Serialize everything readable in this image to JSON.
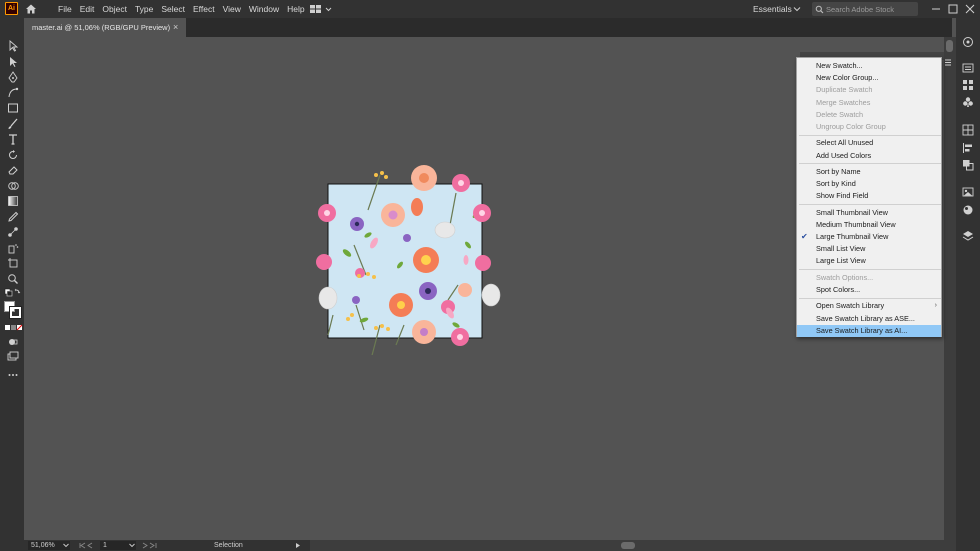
{
  "app": {
    "logo_text": "Ai",
    "menus": [
      "File",
      "Edit",
      "Object",
      "Type",
      "Select",
      "Effect",
      "View",
      "Window",
      "Help"
    ],
    "workspace": "Essentials",
    "search_placeholder": "Search Adobe Stock"
  },
  "document": {
    "tab_title": "master.ai @ 51,06% (RGB/GPU Preview)",
    "close_glyph": "×"
  },
  "status": {
    "zoom": "51,06%",
    "artboard": "1",
    "tool": "Selection"
  },
  "flyout": {
    "groups": [
      [
        {
          "label": "New Swatch...",
          "disabled": false
        },
        {
          "label": "New Color Group...",
          "disabled": false
        },
        {
          "label": "Duplicate Swatch",
          "disabled": true
        },
        {
          "label": "Merge Swatches",
          "disabled": true
        },
        {
          "label": "Delete Swatch",
          "disabled": true
        },
        {
          "label": "Ungroup Color Group",
          "disabled": true
        }
      ],
      [
        {
          "label": "Select All Unused",
          "disabled": false
        },
        {
          "label": "Add Used Colors",
          "disabled": false
        }
      ],
      [
        {
          "label": "Sort by Name",
          "disabled": false
        },
        {
          "label": "Sort by Kind",
          "disabled": false
        },
        {
          "label": "Show Find Field",
          "disabled": false
        }
      ],
      [
        {
          "label": "Small Thumbnail View",
          "disabled": false
        },
        {
          "label": "Medium Thumbnail View",
          "disabled": false
        },
        {
          "label": "Large Thumbnail View",
          "disabled": false,
          "checked": true
        },
        {
          "label": "Small List View",
          "disabled": false
        },
        {
          "label": "Large List View",
          "disabled": false
        }
      ],
      [
        {
          "label": "Swatch Options...",
          "disabled": true
        },
        {
          "label": "Spot Colors...",
          "disabled": false
        }
      ],
      [
        {
          "label": "Open Swatch Library",
          "disabled": false,
          "submenu": true
        },
        {
          "label": "Save Swatch Library as ASE...",
          "disabled": false
        },
        {
          "label": "Save Swatch Library as AI...",
          "disabled": false,
          "highlighted": true
        }
      ]
    ]
  },
  "colors": {
    "chrome_dark": "#323232",
    "canvas": "#535353",
    "artboard_fill": "#cfe6f3",
    "highlight": "#90c8f6",
    "accent": "#ff9a00"
  }
}
